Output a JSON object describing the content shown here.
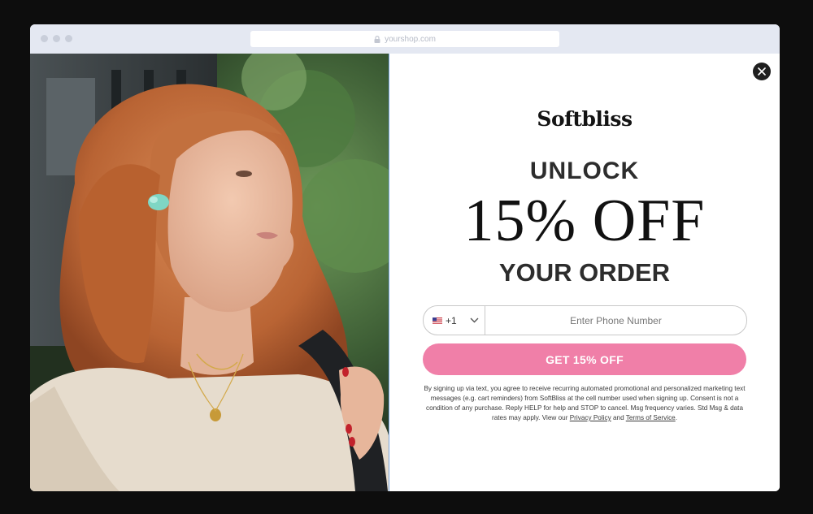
{
  "browser": {
    "url": "yourshop.com",
    "icons": {
      "lock": "lock-icon"
    }
  },
  "popup": {
    "brand": "Softbliss",
    "headline_top": "UNLOCK",
    "headline_main": "15% OFF",
    "headline_bottom": "YOUR ORDER",
    "close_icon": "close-icon",
    "phone": {
      "country_flag": "us-flag-icon",
      "dial_code": "+1",
      "dropdown_icon": "chevron-down-icon",
      "placeholder": "Enter Phone Number",
      "value": ""
    },
    "cta_label": "GET 15% OFF",
    "disclaimer": {
      "text": "By signing up via text, you agree to receive recurring automated promotional and personalized marketing text messages (e.g. cart reminders) from SoftBliss at the cell number used when signing up. Consent is not a condition of any purchase. Reply HELP for help and STOP to cancel. Msg frequency varies. Std Msg & data rates may apply. View our ",
      "privacy_link": "Privacy Policy",
      "and": " and ",
      "terms_link": "Terms of Service",
      "end": "."
    }
  },
  "colors": {
    "page_background": "#0d0d0d",
    "cta_pink": "#f07fa8",
    "chrome_bar": "#e4e8f2"
  }
}
